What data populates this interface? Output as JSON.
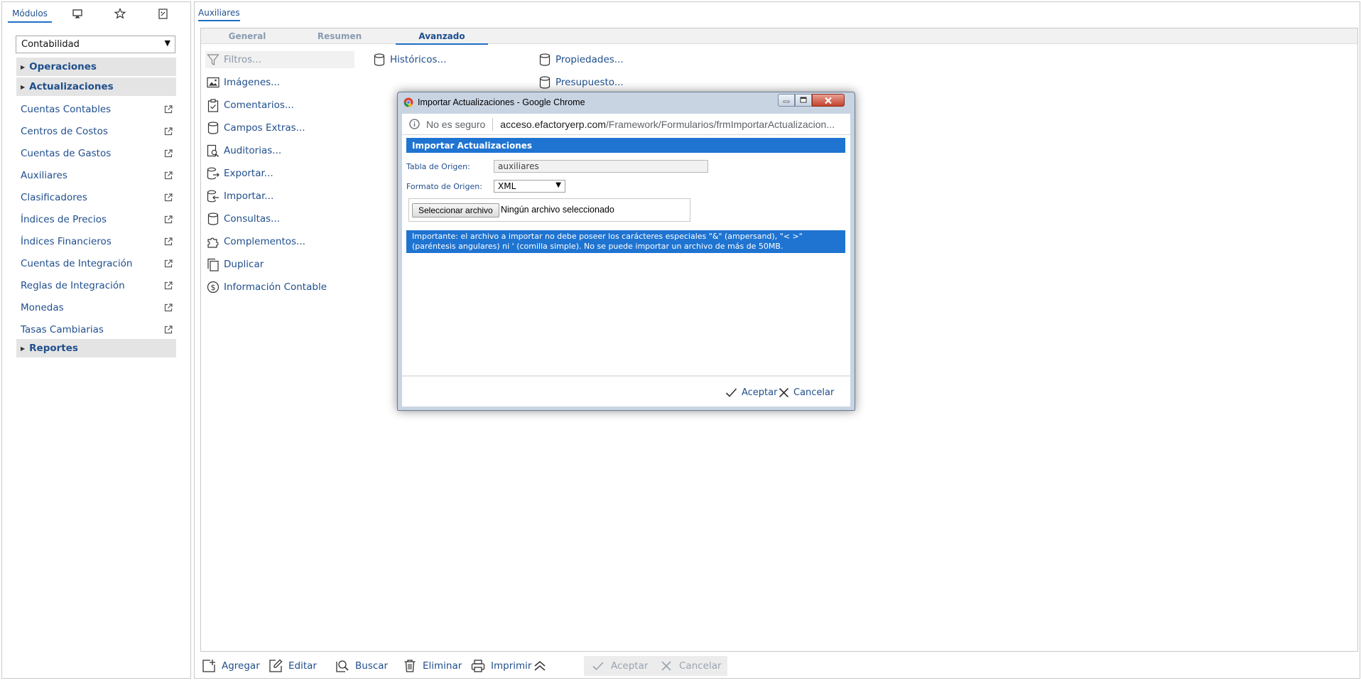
{
  "left_panel": {
    "tabs": {
      "modulos": "Módulos"
    },
    "module_select": {
      "value": "Contabilidad"
    },
    "sections": {
      "operaciones": "Operaciones",
      "actualizaciones": "Actualizaciones",
      "reportes": "Reportes"
    },
    "menu_items": [
      "Cuentas Contables",
      "Centros de Costos",
      "Cuentas de Gastos",
      "Auxiliares",
      "Clasificadores",
      "Índices de Precios",
      "Índices Financieros",
      "Cuentas de Integración",
      "Reglas de Integración",
      "Monedas",
      "Tasas Cambiarias"
    ]
  },
  "main": {
    "tab": "Auxiliares",
    "subtabs": {
      "general": "General",
      "resumen": "Resumen",
      "avanzado": "Avanzado"
    },
    "actions": {
      "filtros": "Filtros...",
      "imagenes": "Imágenes...",
      "comentarios": "Comentarios...",
      "campos_extras": "Campos Extras...",
      "auditorias": "Auditorias...",
      "exportar": "Exportar...",
      "importar": "Importar...",
      "consultas": "Consultas...",
      "complementos": "Complementos...",
      "duplicar": "Duplicar",
      "informacion_contable": "Información Contable",
      "historicos": "Históricos...",
      "propiedades": "Propiedades...",
      "presupuesto": "Presupuesto..."
    },
    "toolbar": {
      "agregar": "Agregar",
      "editar": "Editar",
      "buscar": "Buscar",
      "eliminar": "Eliminar",
      "imprimir": "Imprimir",
      "aceptar": "Aceptar",
      "cancelar": "Cancelar"
    }
  },
  "popup": {
    "window_title": "Importar Actualizaciones - Google Chrome",
    "not_secure": "No es seguro",
    "url_host": "acceso.efactoryerp.com",
    "url_path": "/Framework/Formularios/frmImportarActualizacion...",
    "dialog_title": "Importar Actualizaciones",
    "tabla_label": "Tabla de Origen:",
    "tabla_value": "auxiliares",
    "formato_label": "Formato de Origen:",
    "formato_value": "XML",
    "file_button": "Seleccionar archivo",
    "file_status": "Ningún archivo seleccionado",
    "notice": "Importante: el archivo a importar no debe poseer los carácteres especiales \"&\" (ampersand), \"< >\" (paréntesis angulares) ni ' (comilla simple). No se puede importar un archivo de más de 50MB.",
    "aceptar": "Aceptar",
    "cancelar": "Cancelar"
  },
  "colors": {
    "accent": "#1f74d1",
    "link_text": "#1f4e8c",
    "section_bg": "#e4e4e4"
  }
}
